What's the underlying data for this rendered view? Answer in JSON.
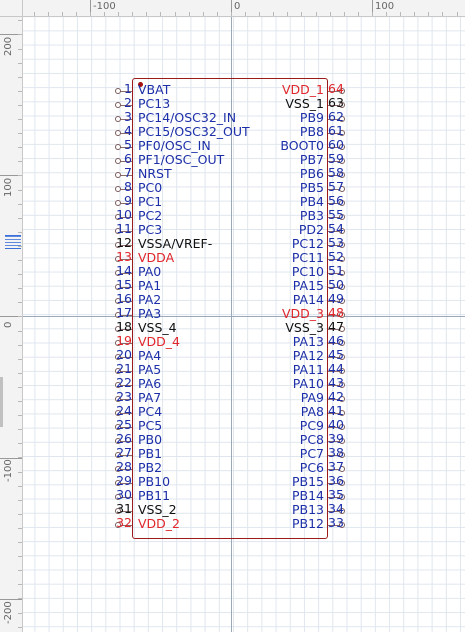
{
  "ruler": {
    "top_labels": [
      "-100",
      "0",
      "100"
    ],
    "left_labels": [
      "200",
      "100",
      "0",
      "-100",
      "-200"
    ]
  },
  "colors": {
    "signal": "#1c2fa8",
    "power": "#e0262b",
    "ground": "#111111",
    "body_outline": "#9b1b1b"
  },
  "left_pins": [
    {
      "num": "1",
      "name": "VBAT",
      "kind": "signal"
    },
    {
      "num": "2",
      "name": "PC13",
      "kind": "signal"
    },
    {
      "num": "3",
      "name": "PC14/OSC32_IN",
      "kind": "signal"
    },
    {
      "num": "4",
      "name": "PC15/OSC32_OUT",
      "kind": "signal"
    },
    {
      "num": "5",
      "name": "PF0/OSC_IN",
      "kind": "signal"
    },
    {
      "num": "6",
      "name": "PF1/OSC_OUT",
      "kind": "signal"
    },
    {
      "num": "7",
      "name": "NRST",
      "kind": "signal"
    },
    {
      "num": "8",
      "name": "PC0",
      "kind": "signal"
    },
    {
      "num": "9",
      "name": "PC1",
      "kind": "signal"
    },
    {
      "num": "10",
      "name": "PC2",
      "kind": "signal"
    },
    {
      "num": "11",
      "name": "PC3",
      "kind": "signal"
    },
    {
      "num": "12",
      "name": "VSSA/VREF-",
      "kind": "ground"
    },
    {
      "num": "13",
      "name": "VDDA",
      "kind": "power"
    },
    {
      "num": "14",
      "name": "PA0",
      "kind": "signal"
    },
    {
      "num": "15",
      "name": "PA1",
      "kind": "signal"
    },
    {
      "num": "16",
      "name": "PA2",
      "kind": "signal"
    },
    {
      "num": "17",
      "name": "PA3",
      "kind": "signal"
    },
    {
      "num": "18",
      "name": "VSS_4",
      "kind": "ground"
    },
    {
      "num": "19",
      "name": "VDD_4",
      "kind": "power"
    },
    {
      "num": "20",
      "name": "PA4",
      "kind": "signal"
    },
    {
      "num": "21",
      "name": "PA5",
      "kind": "signal"
    },
    {
      "num": "22",
      "name": "PA6",
      "kind": "signal"
    },
    {
      "num": "23",
      "name": "PA7",
      "kind": "signal"
    },
    {
      "num": "24",
      "name": "PC4",
      "kind": "signal"
    },
    {
      "num": "25",
      "name": "PC5",
      "kind": "signal"
    },
    {
      "num": "26",
      "name": "PB0",
      "kind": "signal"
    },
    {
      "num": "27",
      "name": "PB1",
      "kind": "signal"
    },
    {
      "num": "28",
      "name": "PB2",
      "kind": "signal"
    },
    {
      "num": "29",
      "name": "PB10",
      "kind": "signal"
    },
    {
      "num": "30",
      "name": "PB11",
      "kind": "signal"
    },
    {
      "num": "31",
      "name": "VSS_2",
      "kind": "ground"
    },
    {
      "num": "32",
      "name": "VDD_2",
      "kind": "power"
    }
  ],
  "right_pins": [
    {
      "num": "64",
      "name": "VDD_1",
      "kind": "power"
    },
    {
      "num": "63",
      "name": "VSS_1",
      "kind": "ground"
    },
    {
      "num": "62",
      "name": "PB9",
      "kind": "signal"
    },
    {
      "num": "61",
      "name": "PB8",
      "kind": "signal"
    },
    {
      "num": "60",
      "name": "BOOT0",
      "kind": "signal"
    },
    {
      "num": "59",
      "name": "PB7",
      "kind": "signal"
    },
    {
      "num": "58",
      "name": "PB6",
      "kind": "signal"
    },
    {
      "num": "57",
      "name": "PB5",
      "kind": "signal"
    },
    {
      "num": "56",
      "name": "PB4",
      "kind": "signal"
    },
    {
      "num": "55",
      "name": "PB3",
      "kind": "signal"
    },
    {
      "num": "54",
      "name": "PD2",
      "kind": "signal"
    },
    {
      "num": "53",
      "name": "PC12",
      "kind": "signal"
    },
    {
      "num": "52",
      "name": "PC11",
      "kind": "signal"
    },
    {
      "num": "51",
      "name": "PC10",
      "kind": "signal"
    },
    {
      "num": "50",
      "name": "PA15",
      "kind": "signal"
    },
    {
      "num": "49",
      "name": "PA14",
      "kind": "signal"
    },
    {
      "num": "48",
      "name": "VDD_3",
      "kind": "power"
    },
    {
      "num": "47",
      "name": "VSS_3",
      "kind": "ground"
    },
    {
      "num": "46",
      "name": "PA13",
      "kind": "signal"
    },
    {
      "num": "45",
      "name": "PA12",
      "kind": "signal"
    },
    {
      "num": "44",
      "name": "PA11",
      "kind": "signal"
    },
    {
      "num": "43",
      "name": "PA10",
      "kind": "signal"
    },
    {
      "num": "42",
      "name": "PA9",
      "kind": "signal"
    },
    {
      "num": "41",
      "name": "PA8",
      "kind": "signal"
    },
    {
      "num": "40",
      "name": "PC9",
      "kind": "signal"
    },
    {
      "num": "39",
      "name": "PC8",
      "kind": "signal"
    },
    {
      "num": "38",
      "name": "PC7",
      "kind": "signal"
    },
    {
      "num": "37",
      "name": "PC6",
      "kind": "signal"
    },
    {
      "num": "36",
      "name": "PB15",
      "kind": "signal"
    },
    {
      "num": "35",
      "name": "PB14",
      "kind": "signal"
    },
    {
      "num": "34",
      "name": "PB13",
      "kind": "signal"
    },
    {
      "num": "33",
      "name": "PB12",
      "kind": "signal"
    }
  ]
}
